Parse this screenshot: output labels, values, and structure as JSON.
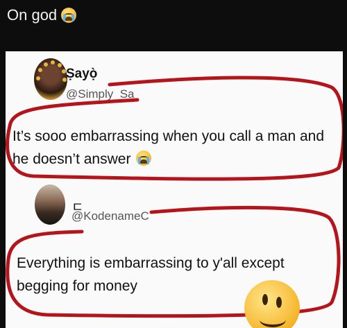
{
  "post": {
    "caption": "On god",
    "caption_emoji": "loudly-crying-face-icon"
  },
  "tweet_1": {
    "display_name": "Ṣayọ̀",
    "handle": "@Simply_Sa",
    "text": "It’s sooo embarrassing when you call a man and he doesn’t answer"
  },
  "tweet_2": {
    "display_name": "ㄷ",
    "handle": "@KodenameC",
    "text": "Everything is embarrassing to y'all except begging for money"
  },
  "colors": {
    "background": "#0d0d0d",
    "card": "#fafafa",
    "annotation": "#b5141b",
    "emoji": "#f5b52b"
  }
}
